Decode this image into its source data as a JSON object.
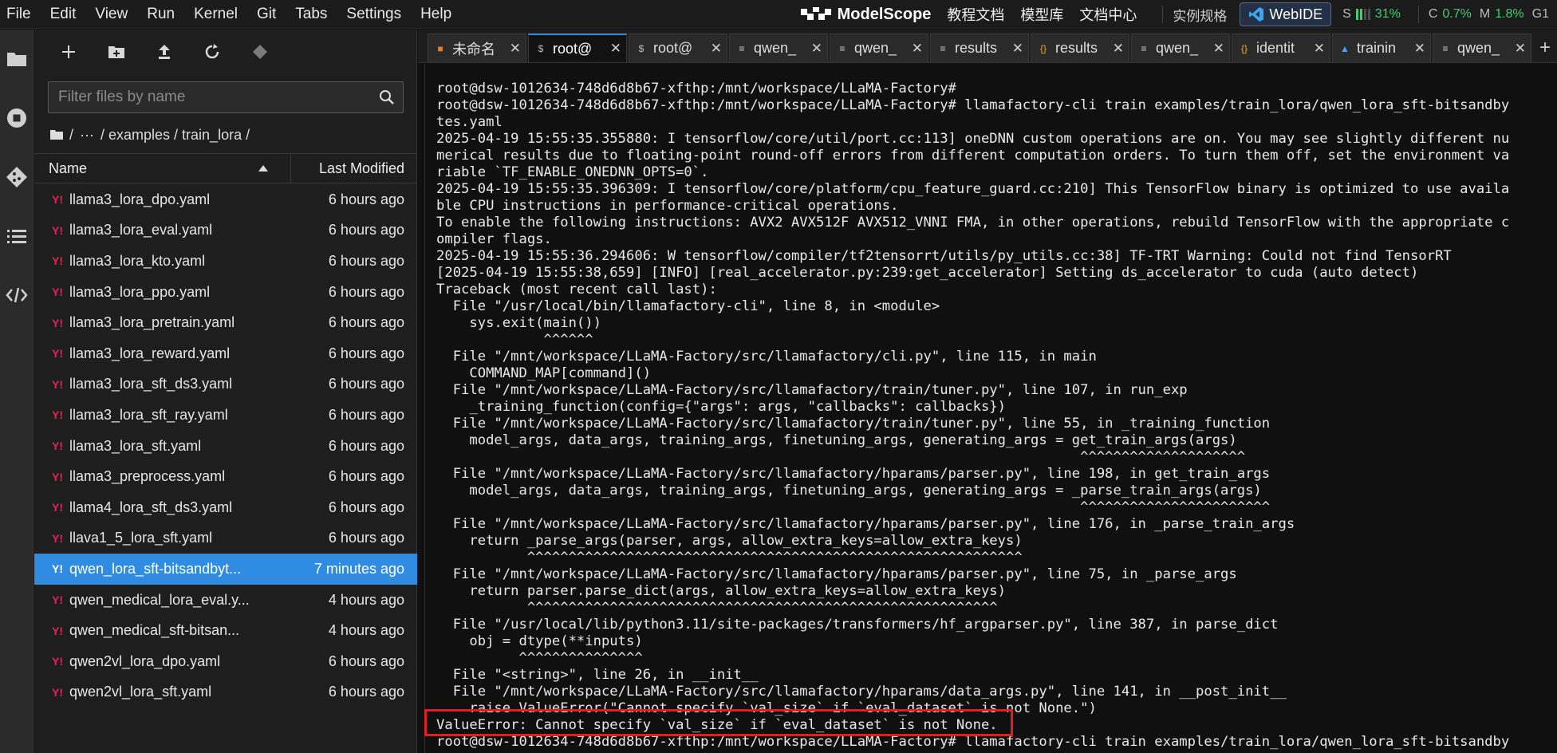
{
  "menubar": {
    "items": [
      "File",
      "Edit",
      "View",
      "Run",
      "Kernel",
      "Git",
      "Tabs",
      "Settings",
      "Help"
    ],
    "brand": "ModelScope",
    "nav": [
      "教程文档",
      "模型库",
      "文档中心"
    ],
    "spec_label": "实例规格",
    "webide_label": "WebIDE",
    "stat_s_label": "S",
    "stat_s_value": "31%",
    "stat_c_label": "C",
    "stat_c_value": "0.7%",
    "stat_m_label": "M",
    "stat_m_value": "1.8%",
    "stat_g_label": "G1"
  },
  "filebrowser": {
    "filter_placeholder": "Filter files by name",
    "breadcrumb": [
      "/",
      "···",
      "/ examples / train_lora /"
    ],
    "col_name": "Name",
    "col_modified": "Last Modified",
    "files": [
      {
        "name": "llama3_lora_dpo.yaml",
        "modified": "6 hours ago"
      },
      {
        "name": "llama3_lora_eval.yaml",
        "modified": "6 hours ago"
      },
      {
        "name": "llama3_lora_kto.yaml",
        "modified": "6 hours ago"
      },
      {
        "name": "llama3_lora_ppo.yaml",
        "modified": "6 hours ago"
      },
      {
        "name": "llama3_lora_pretrain.yaml",
        "modified": "6 hours ago"
      },
      {
        "name": "llama3_lora_reward.yaml",
        "modified": "6 hours ago"
      },
      {
        "name": "llama3_lora_sft_ds3.yaml",
        "modified": "6 hours ago"
      },
      {
        "name": "llama3_lora_sft_ray.yaml",
        "modified": "6 hours ago"
      },
      {
        "name": "llama3_lora_sft.yaml",
        "modified": "6 hours ago"
      },
      {
        "name": "llama3_preprocess.yaml",
        "modified": "6 hours ago"
      },
      {
        "name": "llama4_lora_sft_ds3.yaml",
        "modified": "6 hours ago"
      },
      {
        "name": "llava1_5_lora_sft.yaml",
        "modified": "6 hours ago"
      },
      {
        "name": "qwen_lora_sft-bitsandbyt...",
        "modified": "7 minutes ago",
        "selected": true
      },
      {
        "name": "qwen_medical_lora_eval.y...",
        "modified": "4 hours ago"
      },
      {
        "name": "qwen_medical_sft-bitsan...",
        "modified": "4 hours ago"
      },
      {
        "name": "qwen2vl_lora_dpo.yaml",
        "modified": "6 hours ago"
      },
      {
        "name": "qwen2vl_lora_sft.yaml",
        "modified": "6 hours ago"
      }
    ]
  },
  "tabs": [
    {
      "label": "未命名",
      "icon": "notebook-icon",
      "color": "#e67e22"
    },
    {
      "label": "root@",
      "icon": "terminal-icon",
      "color": "#bbbbbb",
      "active": true
    },
    {
      "label": "root@",
      "icon": "terminal-icon",
      "color": "#bbbbbb"
    },
    {
      "label": "qwen_",
      "icon": "text-file-icon",
      "color": "#cccccc"
    },
    {
      "label": "qwen_",
      "icon": "text-file-icon",
      "color": "#cccccc"
    },
    {
      "label": "results",
      "icon": "text-file-icon",
      "color": "#cccccc"
    },
    {
      "label": "results",
      "icon": "json-icon",
      "color": "#f0ad20"
    },
    {
      "label": "qwen_",
      "icon": "text-file-icon",
      "color": "#cccccc"
    },
    {
      "label": "identit",
      "icon": "json-icon",
      "color": "#f0ad20"
    },
    {
      "label": "trainin",
      "icon": "image-icon",
      "color": "#4ba3ff"
    },
    {
      "label": "qwen_",
      "icon": "text-file-icon",
      "color": "#cccccc"
    }
  ],
  "terminal": {
    "lines": [
      "root@dsw-1012634-748d6d8b67-xfthp:/mnt/workspace/LLaMA-Factory#",
      "root@dsw-1012634-748d6d8b67-xfthp:/mnt/workspace/LLaMA-Factory# llamafactory-cli train examples/train_lora/qwen_lora_sft-bitsandby",
      "tes.yaml",
      "2025-04-19 15:55:35.355880: I tensorflow/core/util/port.cc:113] oneDNN custom operations are on. You may see slightly different nu",
      "merical results due to floating-point round-off errors from different computation orders. To turn them off, set the environment va",
      "riable `TF_ENABLE_ONEDNN_OPTS=0`.",
      "2025-04-19 15:55:35.396309: I tensorflow/core/platform/cpu_feature_guard.cc:210] This TensorFlow binary is optimized to use availa",
      "ble CPU instructions in performance-critical operations.",
      "To enable the following instructions: AVX2 AVX512F AVX512_VNNI FMA, in other operations, rebuild TensorFlow with the appropriate c",
      "ompiler flags.",
      "2025-04-19 15:55:36.294606: W tensorflow/compiler/tf2tensorrt/utils/py_utils.cc:38] TF-TRT Warning: Could not find TensorRT",
      "[2025-04-19 15:55:38,659] [INFO] [real_accelerator.py:239:get_accelerator] Setting ds_accelerator to cuda (auto detect)",
      "Traceback (most recent call last):",
      "  File \"/usr/local/bin/llamafactory-cli\", line 8, in <module>",
      "    sys.exit(main())",
      "             ^^^^^^",
      "  File \"/mnt/workspace/LLaMA-Factory/src/llamafactory/cli.py\", line 115, in main",
      "    COMMAND_MAP[command]()",
      "  File \"/mnt/workspace/LLaMA-Factory/src/llamafactory/train/tuner.py\", line 107, in run_exp",
      "    _training_function(config={\"args\": args, \"callbacks\": callbacks})",
      "  File \"/mnt/workspace/LLaMA-Factory/src/llamafactory/train/tuner.py\", line 55, in _training_function",
      "    model_args, data_args, training_args, finetuning_args, generating_args = get_train_args(args)",
      "                                                                              ^^^^^^^^^^^^^^^^^^^^",
      "  File \"/mnt/workspace/LLaMA-Factory/src/llamafactory/hparams/parser.py\", line 198, in get_train_args",
      "    model_args, data_args, training_args, finetuning_args, generating_args = _parse_train_args(args)",
      "                                                                              ^^^^^^^^^^^^^^^^^^^^^^^",
      "  File \"/mnt/workspace/LLaMA-Factory/src/llamafactory/hparams/parser.py\", line 176, in _parse_train_args",
      "    return _parse_args(parser, args, allow_extra_keys=allow_extra_keys)",
      "           ^^^^^^^^^^^^^^^^^^^^^^^^^^^^^^^^^^^^^^^^^^^^^^^^^^^^^^^^^^^^",
      "  File \"/mnt/workspace/LLaMA-Factory/src/llamafactory/hparams/parser.py\", line 75, in _parse_args",
      "    return parser.parse_dict(args, allow_extra_keys=allow_extra_keys)",
      "           ^^^^^^^^^^^^^^^^^^^^^^^^^^^^^^^^^^^^^^^^^^^^^^^^^^^^^^^^^",
      "  File \"/usr/local/lib/python3.11/site-packages/transformers/hf_argparser.py\", line 387, in parse_dict",
      "    obj = dtype(**inputs)",
      "          ^^^^^^^^^^^^^^^",
      "  File \"<string>\", line 26, in __init__",
      "  File \"/mnt/workspace/LLaMA-Factory/src/llamafactory/hparams/data_args.py\", line 141, in __post_init__",
      "    raise ValueError(\"Cannot specify `val_size` if `eval_dataset` is not None.\")",
      "ValueError: Cannot specify `val_size` if `eval_dataset` is not None.",
      "root@dsw-1012634-748d6d8b67-xfthp:/mnt/workspace/LLaMA-Factory# llamafactory-cli train examples/train_lora/qwen_lora_sft-bitsandby"
    ]
  },
  "colors": {
    "selected_row": "#2f8ce0",
    "yaml_icon": "#e0245a",
    "error_highlight": "#e02020",
    "stat_green": "#3ed06f"
  }
}
